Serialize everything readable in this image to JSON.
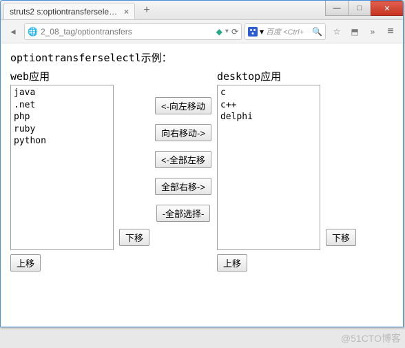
{
  "window": {
    "tab_title": "struts2 s:optiontransferselec...",
    "new_tab": "+"
  },
  "addressbar": {
    "url": "2_08_tag/optiontransfers",
    "search_placeholder": "百度 <Ctrl+"
  },
  "page": {
    "title": "optiontransferselectl示例："
  },
  "left": {
    "label": "web应用",
    "items": [
      "java",
      ".net",
      "php",
      "ruby",
      "python"
    ],
    "down_label": "下移",
    "up_label": "上移"
  },
  "right": {
    "label": "desktop应用",
    "items": [
      "c",
      "c++",
      "delphi"
    ],
    "down_label": "下移",
    "up_label": "上移"
  },
  "mover": {
    "move_left": "<-向左移动",
    "move_right": "向右移动->",
    "all_left": "<-全部左移",
    "all_right": "全部右移->",
    "select_all": "-全部选择-"
  },
  "watermark": "@51CTO博客"
}
